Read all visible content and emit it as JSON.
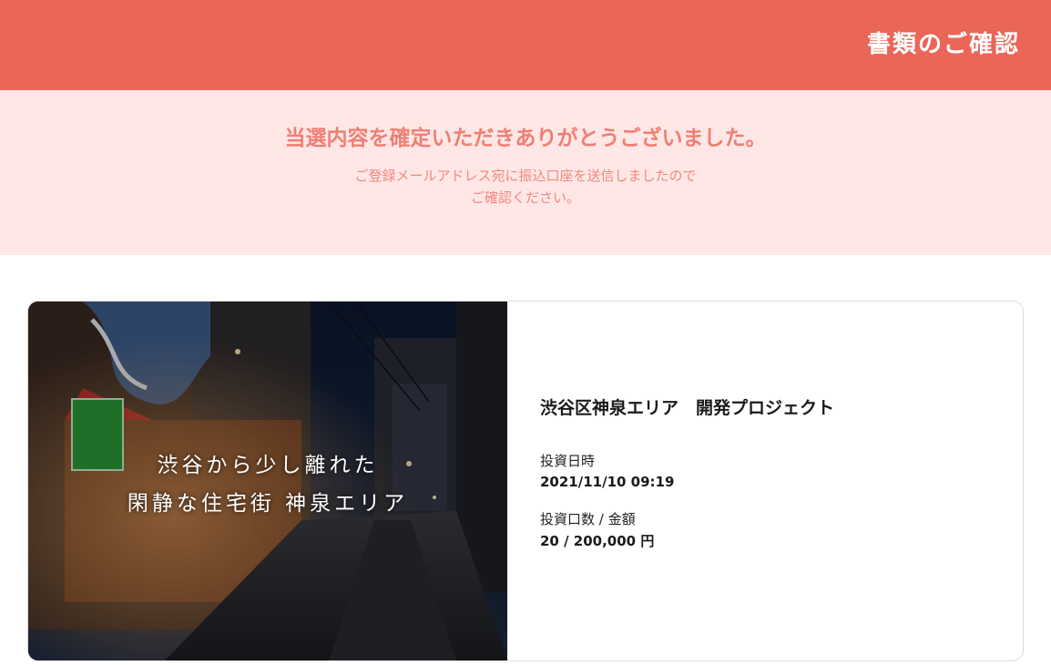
{
  "header": {
    "title": "書類のご確認",
    "bg_color": "#ea6658"
  },
  "banner": {
    "heading": "当選内容を確定いただきありがとうございました。",
    "message_line1": "ご登録メールアドレス宛に振込口座を送信しましたので",
    "message_line2": "ご確認ください。",
    "bg_color": "#ffe7e6",
    "text_color": "#f07f74"
  },
  "project": {
    "image_caption_line1": "渋谷から少し離れた",
    "image_caption_line2": "閑静な住宅街 神泉エリア",
    "name": "渋谷区神泉エリア　開発プロジェクト",
    "investment_date_label": "投資日時",
    "investment_date": "2021/11/10 09:19",
    "units_amount_label": "投資口数 / 金額",
    "units_amount": "20 / 200,000 円"
  }
}
